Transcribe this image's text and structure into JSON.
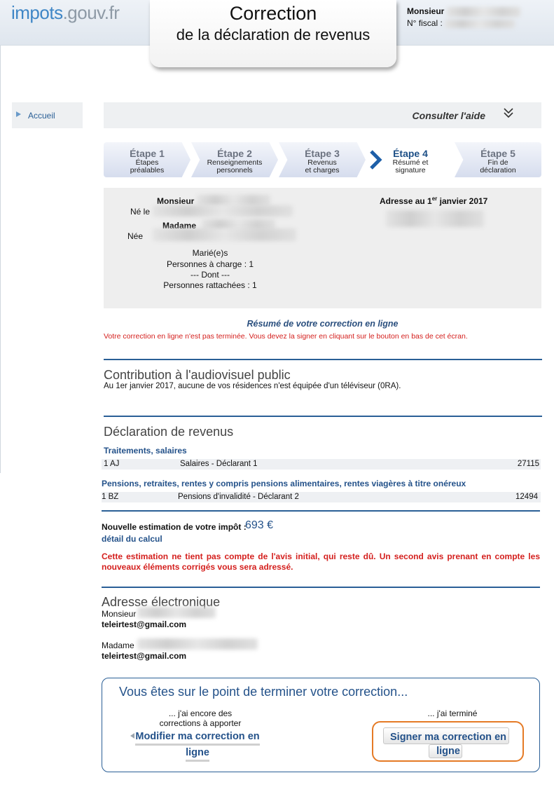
{
  "header": {
    "logo_part1": "impots",
    "logo_part2": ".gouv.fr",
    "title_line1": "Correction",
    "title_line2": "de la déclaration de revenus",
    "user_title": "Monsieur",
    "fiscal_label": "N° fiscal :"
  },
  "nav": {
    "accueil": "Accueil"
  },
  "help": {
    "label": "Consulter l'aide",
    "icon": "double-chevron-down-icon"
  },
  "steps": [
    {
      "title": "Étape 1",
      "desc1": "Étapes",
      "desc2": "préalables"
    },
    {
      "title": "Étape 2",
      "desc1": "Renseignements",
      "desc2": "personnels"
    },
    {
      "title": "Étape 3",
      "desc1": "Revenus",
      "desc2": "et charges"
    },
    {
      "title": "Étape 4",
      "desc1": "Résumé et",
      "desc2": "signature"
    },
    {
      "title": "Étape 5",
      "desc1": "Fin de",
      "desc2": "déclaration"
    }
  ],
  "identity": {
    "monsieur": "Monsieur",
    "ne_le": "Né le",
    "madame": "Madame",
    "nee": "Née",
    "situation": "Marié(e)s",
    "charge": "Personnes à charge : 1",
    "dont": "--- Dont ---",
    "rattachees": "Personnes rattachées : 1",
    "address_label": "Adresse au 1",
    "address_sup": "er",
    "address_rest": " janvier 2017"
  },
  "summary": {
    "title": "Résumé de votre correction en ligne",
    "warning": "Votre correction en ligne n'est pas terminée. Vous devez la signer en cliquant sur le bouton en bas de cet écran."
  },
  "audiovisuel": {
    "title": "Contribution à l'audiovisuel public",
    "text": "Au 1er janvier 2017, aucune de vos résidences n'est équipée d'un téléviseur (0RA)."
  },
  "declaration": {
    "title": "Déclaration de revenus",
    "groups": [
      {
        "heading": "Traitements, salaires",
        "code": "1 AJ",
        "label": "Salaires - Déclarant 1",
        "amount": "27115"
      },
      {
        "heading": "Pensions, retraites, rentes y compris pensions alimentaires, rentes viagères à titre onéreux",
        "code": "1 BZ",
        "label": "Pensions d'invalidité - Déclarant 2",
        "amount": "12494"
      }
    ]
  },
  "estimate": {
    "label": "Nouvelle estimation de votre impôt :",
    "amount": "693 €",
    "detail_link": "détail du calcul",
    "warning": "Cette estimation ne tient pas compte de l'avis initial, qui reste dû. Un second avis prenant en compte les nouveaux éléments corrigés vous sera adressé."
  },
  "email": {
    "title": "Adresse électronique",
    "person1": "Monsieur",
    "email1": "teleirtest@gmail.com",
    "person2": "Madame",
    "email2": "teleirtest@gmail.com"
  },
  "final": {
    "title": "Vous êtes sur le point de terminer votre correction...",
    "still_line1": "... j'ai encore des",
    "still_line2": "corrections à apporter",
    "done": "... j'ai terminé",
    "modify_line1": "Modifier ma correction en",
    "modify_line2": "ligne",
    "sign_line1": "Signer ma correction en",
    "sign_line2": "ligne"
  },
  "colors": {
    "brand_blue": "#24528a",
    "warning_red": "#d4201e",
    "highlight_orange": "#e57a25"
  }
}
